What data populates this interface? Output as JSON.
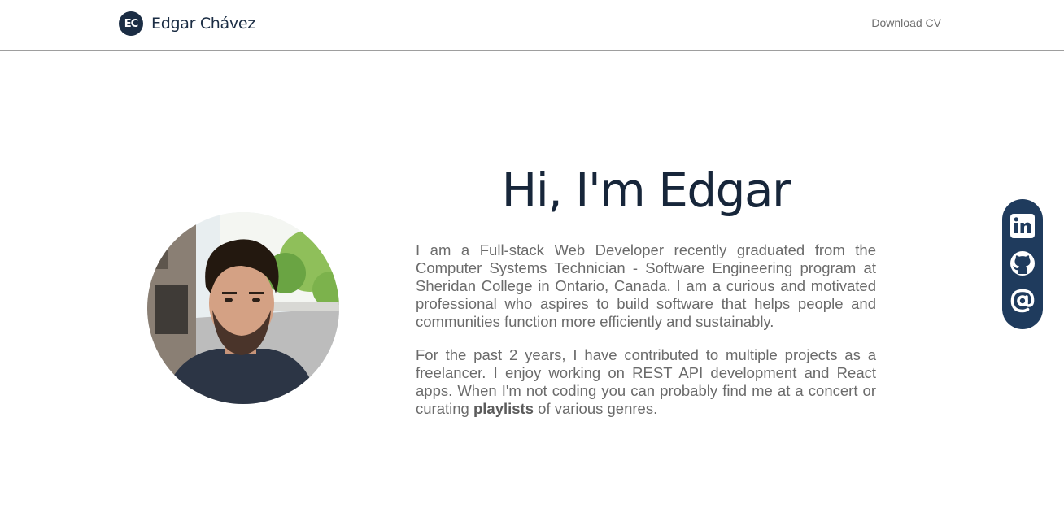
{
  "header": {
    "logo_initials": "EC",
    "brand_name": "Edgar Chávez",
    "download_cv": "Download CV"
  },
  "hero": {
    "heading": "Hi, I'm Edgar",
    "paragraph1": "I am a Full-stack Web Developer recently graduated from the Computer Systems Technician - Software Engineering program at Sheridan College in Ontario, Canada. I am a curious and motivated professional who aspires to build software that helps people and communities function more efficiently and sustainably.",
    "paragraph2_before": "For the past 2 years, I have contributed to multiple projects as a freelancer. I enjoy working on REST API development and React apps. When I'm not coding you can probably find me at a concert or curating ",
    "paragraph2_link": "playlists",
    "paragraph2_after": " of various genres."
  },
  "social": {
    "items": [
      {
        "icon": "linkedin-icon"
      },
      {
        "icon": "github-icon"
      },
      {
        "icon": "email-at-icon"
      }
    ]
  },
  "colors": {
    "brand_navy": "#1b2d44",
    "heading": "#17263a",
    "body_text": "#6b6b6b",
    "social_bar": "#1f3b5d"
  }
}
